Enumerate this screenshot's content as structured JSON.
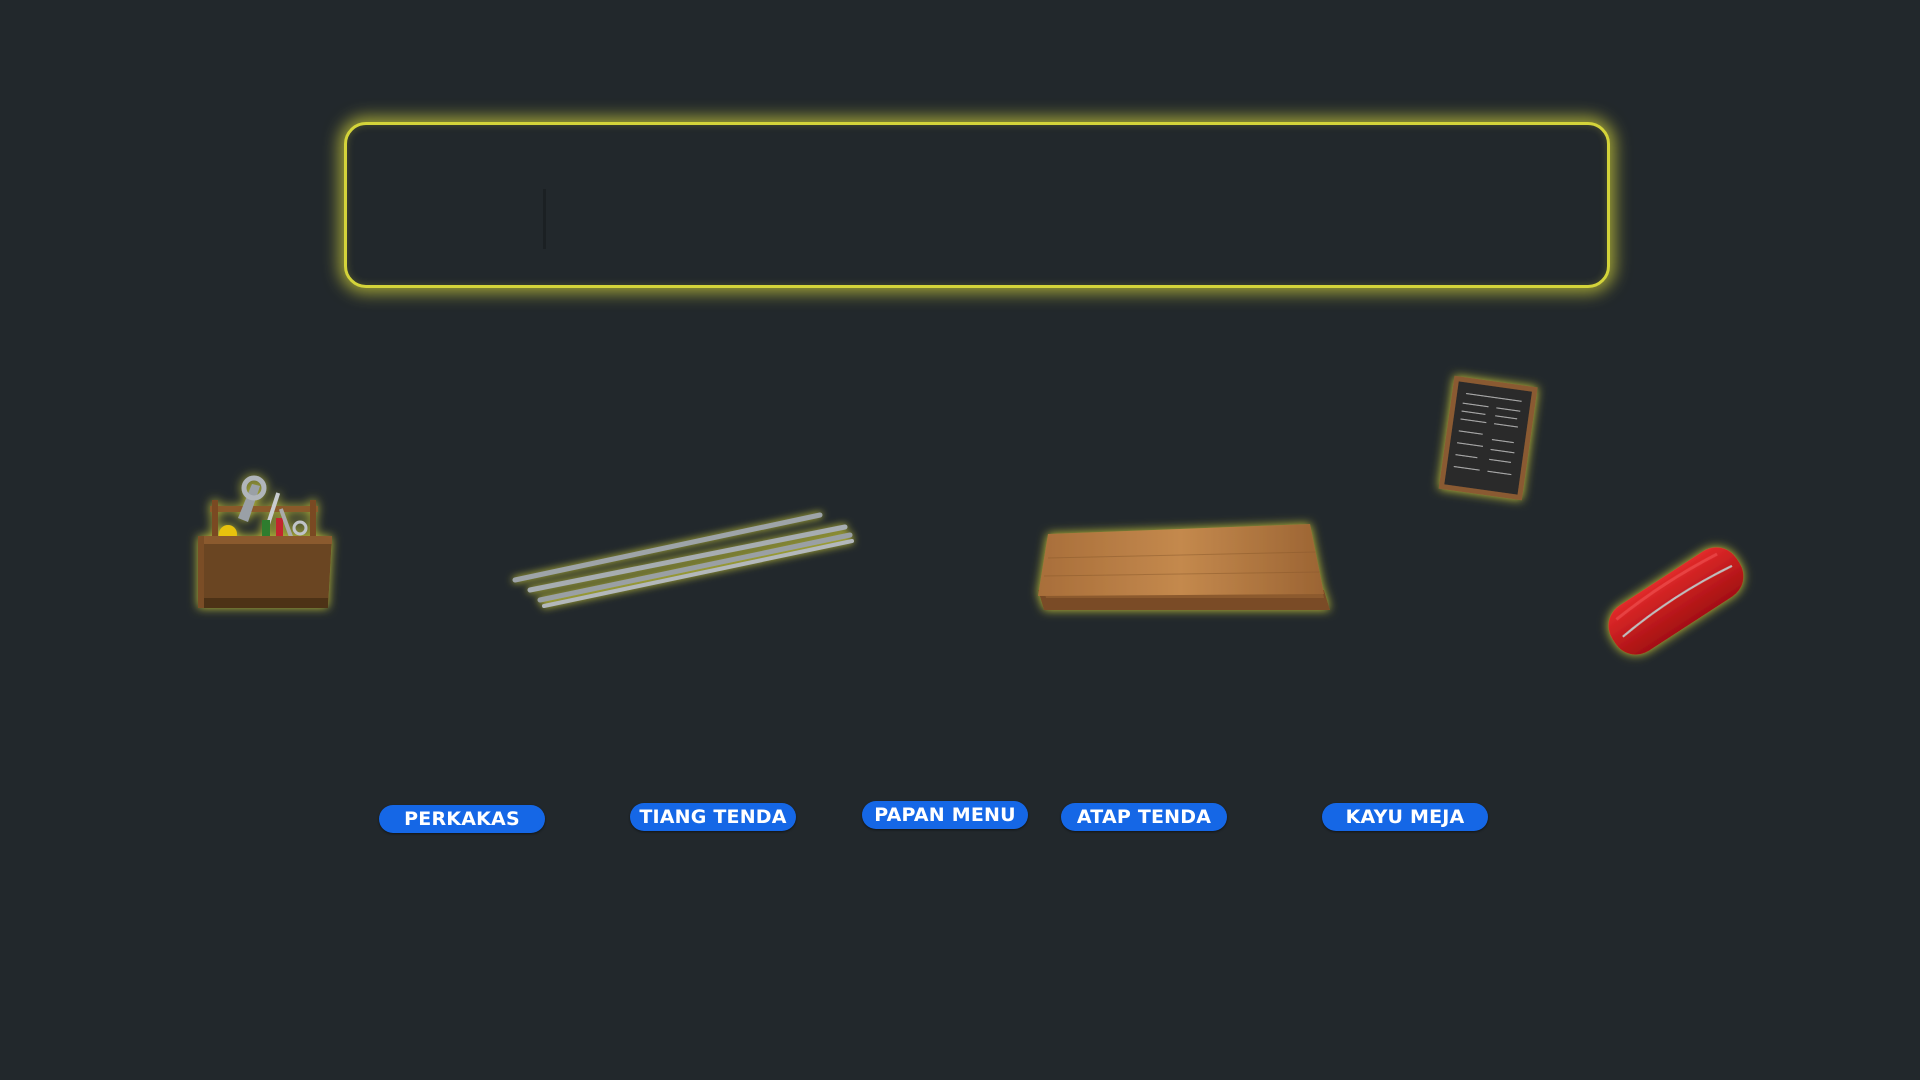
{
  "scene": {
    "background_color": "#22282c",
    "glow_color": "#d4d43a",
    "button_color": "#1567e6"
  },
  "drop_zone": {
    "contents": ""
  },
  "items": [
    {
      "id": "toolbox",
      "icon": "toolbox-icon"
    },
    {
      "id": "tent-poles",
      "icon": "metal-rods-icon"
    },
    {
      "id": "wood-planks",
      "icon": "wood-planks-icon"
    },
    {
      "id": "menu-board",
      "icon": "chalkboard-menu-icon"
    },
    {
      "id": "red-cushion",
      "icon": "red-cushion-icon"
    }
  ],
  "labels": {
    "perkakas": "PERKAKAS",
    "tiang_tenda": "TIANG TENDA",
    "papan_menu": "PAPAN MENU",
    "atap_tenda": "ATAP TENDA",
    "kayu_meja": "KAYU MEJA"
  }
}
